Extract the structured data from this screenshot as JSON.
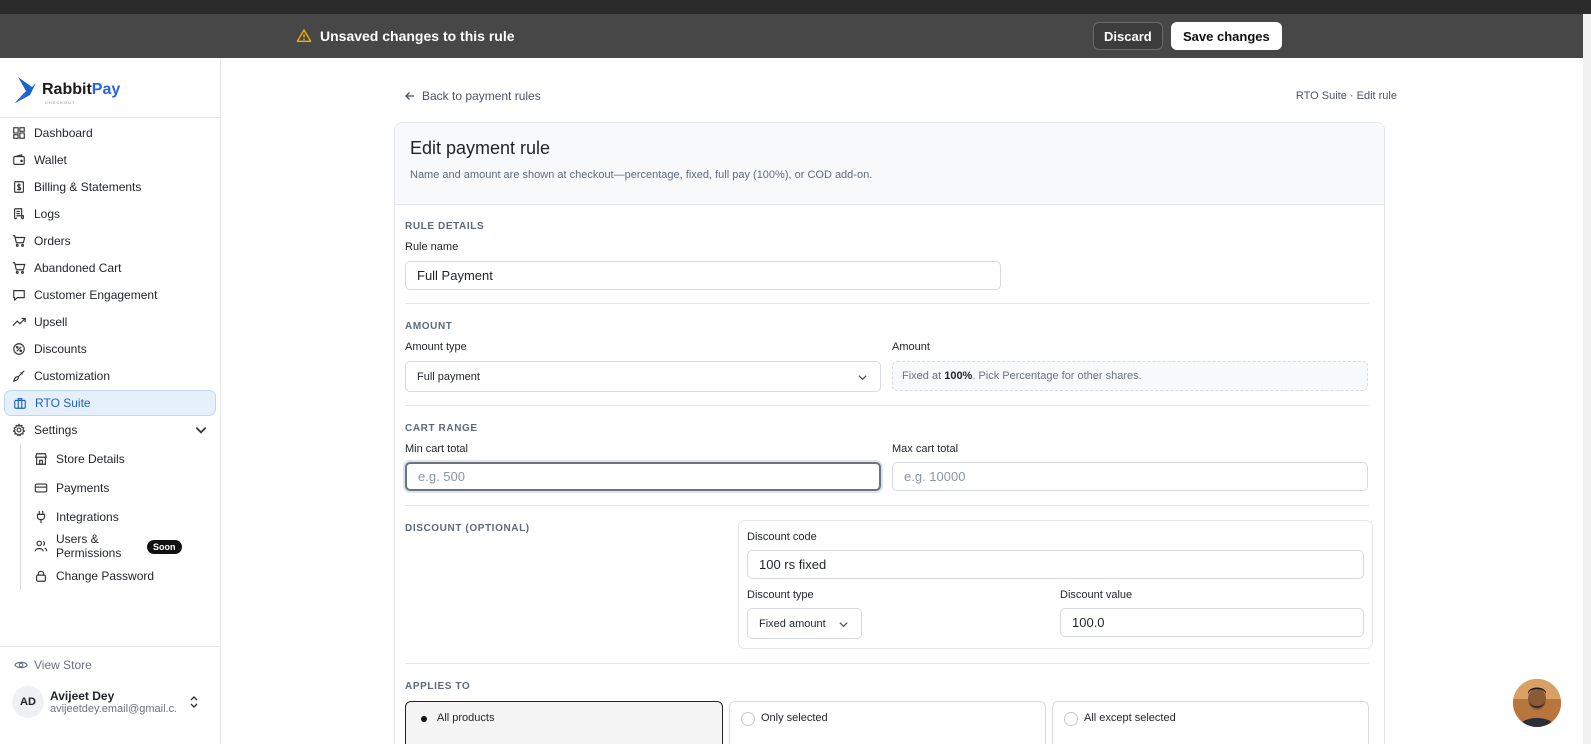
{
  "banner": {
    "message": "Unsaved changes to this rule",
    "discard_label": "Discard",
    "save_label": "Save changes"
  },
  "brand": {
    "name_part1": "Rabbit",
    "name_part2": "Pay",
    "sub": "CHECKOUT"
  },
  "sidebar": {
    "items": [
      {
        "label": "Dashboard",
        "icon": "dashboard-icon"
      },
      {
        "label": "Wallet",
        "icon": "wallet-icon"
      },
      {
        "label": "Billing & Statements",
        "icon": "billing-icon"
      },
      {
        "label": "Logs",
        "icon": "logs-icon"
      },
      {
        "label": "Orders",
        "icon": "cart-icon"
      },
      {
        "label": "Abandoned Cart",
        "icon": "cart-icon"
      },
      {
        "label": "Customer Engagement",
        "icon": "chat-icon"
      },
      {
        "label": "Upsell",
        "icon": "trend-up-icon"
      },
      {
        "label": "Discounts",
        "icon": "discount-icon"
      },
      {
        "label": "Customization",
        "icon": "brush-icon"
      },
      {
        "label": "RTO Suite",
        "icon": "briefcase-icon",
        "active": true
      },
      {
        "label": "Settings",
        "icon": "gear-icon"
      }
    ],
    "settings_sub": [
      {
        "label": "Store Details",
        "icon": "store-icon"
      },
      {
        "label": "Payments",
        "icon": "card-icon"
      },
      {
        "label": "Integrations",
        "icon": "plug-icon"
      },
      {
        "label": "Users & Permissions",
        "icon": "users-icon",
        "badge": "Soon"
      },
      {
        "label": "Change Password",
        "icon": "lock-icon"
      }
    ],
    "view_store": "View Store",
    "user": {
      "initials": "AD",
      "name": "Avijeet Dey",
      "email": "avijeetdey.email@gmail.c..."
    }
  },
  "page": {
    "back_link": "Back to payment rules",
    "breadcrumb": "RTO Suite · Edit rule",
    "title": "Edit payment rule",
    "subtitle": "Name and amount are shown at checkout—percentage, fixed, full pay (100%), or COD add-on."
  },
  "rule_details": {
    "section": "RULE DETAILS",
    "name_label": "Rule name",
    "name_value": "Full Payment"
  },
  "amount": {
    "section": "AMOUNT",
    "type_label": "Amount type",
    "type_value": "Full payment",
    "amount_label": "Amount",
    "fixed_prefix": "Fixed at ",
    "fixed_value": "100%",
    "fixed_suffix": ". Pick Percentage for other shares."
  },
  "cart_range": {
    "section": "CART RANGE",
    "min_label": "Min cart total",
    "min_placeholder": "e.g. 500",
    "max_label": "Max cart total",
    "max_placeholder": "e.g. 10000"
  },
  "discount": {
    "section": "DISCOUNT (OPTIONAL)",
    "code_label": "Discount code",
    "code_value": "100 rs fixed",
    "type_label": "Discount type",
    "type_value": "Fixed amount",
    "value_label": "Discount value",
    "value_value": "100.0"
  },
  "applies_to": {
    "section": "APPLIES TO",
    "options": [
      {
        "label": "All products",
        "selected": true
      },
      {
        "label": "Only selected",
        "selected": false
      },
      {
        "label": "All except selected",
        "selected": false
      }
    ]
  }
}
